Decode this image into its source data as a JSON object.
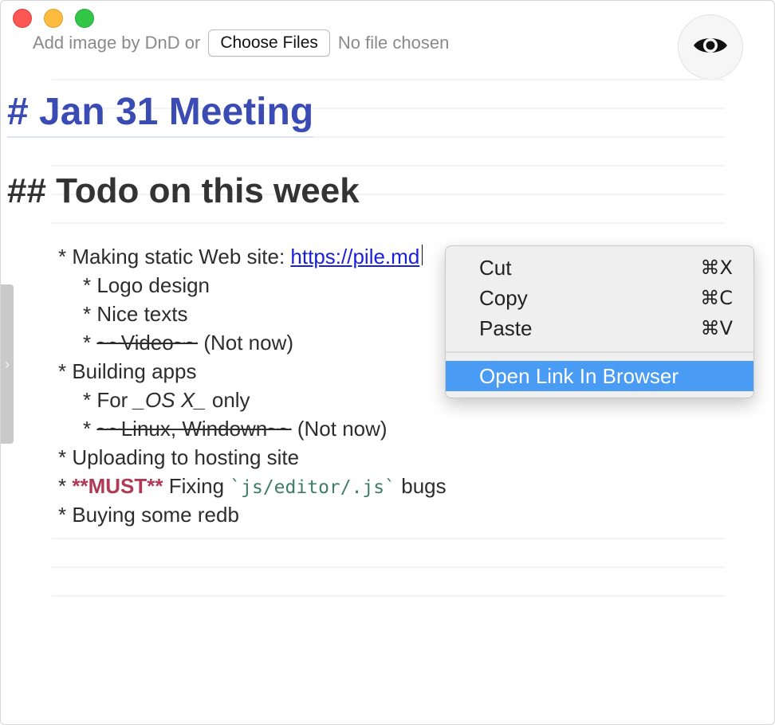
{
  "window": {
    "traffic_lights": [
      "close",
      "minimize",
      "maximize"
    ]
  },
  "file_picker": {
    "prompt": "Add image by DnD or",
    "button_label": "Choose Files",
    "status": "No file chosen"
  },
  "preview_button": {
    "icon": "eye-icon"
  },
  "side_handle": {
    "icon": "chevron-right-icon",
    "glyph": "›"
  },
  "document": {
    "h1": "# Jan 31 Meeting",
    "h2": "## Todo on this week",
    "lines": [
      {
        "prefix": "* Making static Web site: ",
        "link": "https://pile.md"
      },
      {
        "text": "* Logo design"
      },
      {
        "text": "* Nice texts"
      },
      {
        "prefix": "* ",
        "strike": "~~Video~~",
        "suffix": " (Not now)"
      },
      {
        "text": "* Building apps"
      },
      {
        "prefix": "* For ",
        "italic": "_OS X_",
        "suffix": " only"
      },
      {
        "prefix": "* ",
        "strike": "~~Linux, Windown~~",
        "suffix": " (Not now)"
      },
      {
        "text": "* Uploading to hosting site"
      },
      {
        "prefix": "* ",
        "bold": "**MUST**",
        "middle": " Fixing ",
        "code": "`js/editor/.js`",
        "suffix": " bugs"
      },
      {
        "text": "* Buying some redb"
      }
    ]
  },
  "context_menu": {
    "items": [
      {
        "label": "Cut",
        "shortcut": "⌘X"
      },
      {
        "label": "Copy",
        "shortcut": "⌘C"
      },
      {
        "label": "Paste",
        "shortcut": "⌘V"
      }
    ],
    "open_link": "Open Link In Browser"
  },
  "colors": {
    "heading1": "#3a4cb4",
    "link": "#1a1fd9",
    "bold_emphasis": "#b03a55",
    "code": "#3f7d66",
    "menu_highlight": "#4a9bf3"
  }
}
